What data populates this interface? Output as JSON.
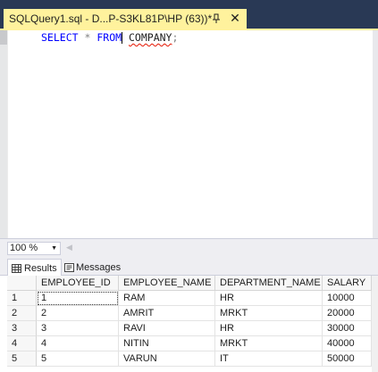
{
  "tab": {
    "title": "SQLQuery1.sql - D...P-S3KL81P\\HP (63))*",
    "close_glyph": "✕",
    "pin_icon": "pin-icon"
  },
  "editor": {
    "keyword_select": "SELECT",
    "star": "*",
    "keyword_from": "FROM",
    "table": "COMPANY",
    "terminator": ";"
  },
  "zoom": {
    "value": "100 %",
    "caret": "▼",
    "scroll_left": "◀"
  },
  "results_tabs": [
    {
      "label": "Results",
      "icon": "grid-icon",
      "active": true
    },
    {
      "label": "Messages",
      "icon": "messages-icon",
      "active": false
    }
  ],
  "grid": {
    "columns": [
      "EMPLOYEE_ID",
      "EMPLOYEE_NAME",
      "DEPARTMENT_NAME",
      "SALARY"
    ],
    "rows": [
      {
        "n": "1",
        "id": "1",
        "name": "RAM",
        "dept": "HR",
        "salary": "10000"
      },
      {
        "n": "2",
        "id": "2",
        "name": "AMRIT",
        "dept": "MRKT",
        "salary": "20000"
      },
      {
        "n": "3",
        "id": "3",
        "name": "RAVI",
        "dept": "HR",
        "salary": "30000"
      },
      {
        "n": "4",
        "id": "4",
        "name": "NITIN",
        "dept": "MRKT",
        "salary": "40000"
      },
      {
        "n": "5",
        "id": "5",
        "name": "VARUN",
        "dept": "IT",
        "salary": "50000"
      }
    ]
  },
  "colors": {
    "tab_strip": "#293955",
    "active_tab": "#fff29d",
    "keyword": "#0000ff",
    "squiggle": "#e51400"
  }
}
